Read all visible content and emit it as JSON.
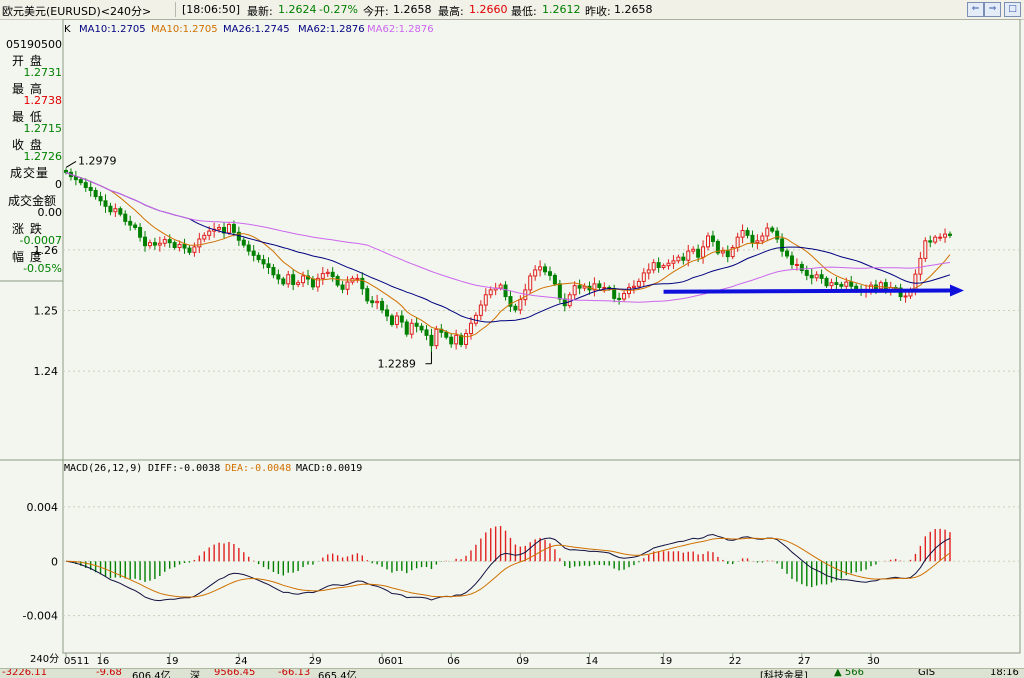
{
  "header": {
    "symbol": "欧元美元(EURUSD)<240分>",
    "time": "[18:06:50]",
    "latest_label": "最新:",
    "latest": "1.2624",
    "change": "-0.27%",
    "open_label": "今开:",
    "open": "1.2658",
    "high_label": "最高:",
    "high": "1.2660",
    "low_label": "最低:",
    "low": "1.2612",
    "prev_label": "昨收:",
    "prev": "1.2658"
  },
  "ma_legend": {
    "prefix": "K",
    "items": [
      {
        "text": "MA10:1.2705",
        "color": "#000080"
      },
      {
        "text": "MA10:1.2705",
        "color": "#d07000"
      },
      {
        "text": "MA26:1.2745",
        "color": "#000080"
      },
      {
        "text": "MA62:1.2876",
        "color": "#000080"
      },
      {
        "text": "MA62:1.2876",
        "color": "#cc66ee"
      }
    ]
  },
  "info_panel": {
    "code": "05190500",
    "rows": [
      {
        "label": "开  盘",
        "value": "1.2731",
        "color": "#008000"
      },
      {
        "label": "最  高",
        "value": "1.2738",
        "color": "#e00000"
      },
      {
        "label": "最  低",
        "value": "1.2715",
        "color": "#008000"
      },
      {
        "label": "收  盘",
        "value": "1.2726",
        "color": "#008000"
      },
      {
        "label": "成交量",
        "value": "0",
        "color": "#000000"
      },
      {
        "label": "成交金额",
        "value": "0.00",
        "color": "#000000"
      },
      {
        "label": "涨  跌",
        "value": "-0.0007",
        "color": "#008000"
      },
      {
        "label": "幅  度",
        "value": "-0.05%",
        "color": "#008000"
      }
    ]
  },
  "macd_legend": {
    "name": "MACD(26,12,9)",
    "diff": "DIFF:-0.0038",
    "dea": "DEA:-0.0048",
    "macd": "MACD:0.0019"
  },
  "period_label": "240分",
  "statusbar": {
    "left": [
      "-3226.11",
      "-9.68",
      "606.4亿",
      "深",
      "9566.45",
      "-66.13",
      "665.4亿"
    ],
    "right": [
      "[科技金星]",
      "▲ 566",
      "GIS",
      "18:16"
    ]
  },
  "chart_data": {
    "type": "candlestick",
    "price_axis": {
      "ticks": [
        1.24,
        1.25,
        1.26
      ],
      "tick_labels": [
        "1.24",
        "1.25",
        "1.26"
      ],
      "range": [
        1.2255,
        1.2915
      ]
    },
    "x_tick_labels": [
      "0511",
      "16",
      "19",
      "24",
      "29",
      "0601",
      "06",
      "09",
      "14",
      "19",
      "22",
      "27",
      "30"
    ],
    "annotations": [
      {
        "text": "1.2979",
        "kind": "high_marker"
      },
      {
        "text": "1.2289",
        "kind": "low_marker"
      }
    ],
    "close": [
      1.2728,
      1.2721,
      1.2716,
      1.2711,
      1.2703,
      1.2698,
      1.2688,
      1.2681,
      1.2672,
      1.2663,
      1.2668,
      1.2659,
      1.2647,
      1.2641,
      1.2637,
      1.2621,
      1.2607,
      1.2612,
      1.2608,
      1.2611,
      1.2617,
      1.2612,
      1.2604,
      1.2609,
      1.2603,
      1.2596,
      1.2605,
      1.2618,
      1.2624,
      1.2631,
      1.2634,
      1.2637,
      1.2628,
      1.2642,
      1.2629,
      1.2616,
      1.2608,
      1.2598,
      1.2591,
      1.2584,
      1.2577,
      1.2571,
      1.2559,
      1.2552,
      1.2544,
      1.2559,
      1.2543,
      1.2546,
      1.2557,
      1.2552,
      1.2539,
      1.2553,
      1.2561,
      1.2563,
      1.2556,
      1.2542,
      1.2535,
      1.2547,
      1.2553,
      1.2553,
      1.2536,
      1.2516,
      1.2513,
      1.2515,
      1.2501,
      1.2491,
      1.2477,
      1.2491,
      1.2481,
      1.2461,
      1.2479,
      1.2474,
      1.2468,
      1.2459,
      1.2442,
      1.2469,
      1.2464,
      1.2456,
      1.2445,
      1.2459,
      1.2444,
      1.2462,
      1.2479,
      1.2492,
      1.2509,
      1.2526,
      1.2534,
      1.2537,
      1.2542,
      1.2523,
      1.2507,
      1.2501,
      1.2518,
      1.2534,
      1.2557,
      1.2567,
      1.2572,
      1.2564,
      1.2558,
      1.2544,
      1.2519,
      1.2508,
      1.2526,
      1.2541,
      1.2537,
      1.254,
      1.2534,
      1.2544,
      1.2538,
      1.2538,
      1.2536,
      1.252,
      1.2519,
      1.2528,
      1.2538,
      1.254,
      1.2548,
      1.2562,
      1.2567,
      1.2579,
      1.2571,
      1.2574,
      1.2578,
      1.2582,
      1.2588,
      1.2583,
      1.2598,
      1.2601,
      1.2588,
      1.2605,
      1.2623,
      1.2614,
      1.2595,
      1.2598,
      1.2589,
      1.2604,
      1.2621,
      1.2632,
      1.2624,
      1.2612,
      1.2615,
      1.2623,
      1.2636,
      1.2631,
      1.2618,
      1.2598,
      1.259,
      1.2576,
      1.2576,
      1.2566,
      1.2558,
      1.2554,
      1.2559,
      1.2553,
      1.2541,
      1.2546,
      1.2543,
      1.254,
      1.2547,
      1.254,
      1.2534,
      1.2532,
      1.2532,
      1.2542,
      1.2536,
      1.2546,
      1.2534,
      1.2538,
      1.2537,
      1.2523,
      1.2524,
      1.2533,
      1.256,
      1.2586,
      1.2615,
      1.2613,
      1.2621,
      1.2621,
      1.2626,
      1.2624
    ],
    "open": [
      1.2731,
      1.2728,
      1.2721,
      1.2716,
      1.2711,
      1.2703,
      1.2698,
      1.2688,
      1.2681,
      1.2672,
      1.2663,
      1.2668,
      1.2659,
      1.2647,
      1.2641,
      1.2637,
      1.2621,
      1.2607,
      1.2612,
      1.2608,
      1.2611,
      1.2617,
      1.2612,
      1.2604,
      1.2609,
      1.2603,
      1.2596,
      1.2605,
      1.2618,
      1.2624,
      1.2631,
      1.2634,
      1.2637,
      1.2628,
      1.2642,
      1.2629,
      1.2616,
      1.2608,
      1.2598,
      1.2591,
      1.2584,
      1.2577,
      1.2571,
      1.2559,
      1.2552,
      1.2544,
      1.2559,
      1.2543,
      1.2546,
      1.2557,
      1.2552,
      1.2539,
      1.2553,
      1.2561,
      1.2563,
      1.2556,
      1.2542,
      1.2535,
      1.2547,
      1.2553,
      1.2553,
      1.2536,
      1.2516,
      1.2513,
      1.2515,
      1.2501,
      1.2491,
      1.2477,
      1.2491,
      1.2481,
      1.2461,
      1.2479,
      1.2474,
      1.2468,
      1.2459,
      1.2442,
      1.2469,
      1.2464,
      1.2456,
      1.2445,
      1.2459,
      1.2444,
      1.2462,
      1.2479,
      1.2492,
      1.2509,
      1.2526,
      1.2534,
      1.2537,
      1.2542,
      1.2523,
      1.2507,
      1.2501,
      1.2518,
      1.2534,
      1.2557,
      1.2567,
      1.2572,
      1.2564,
      1.2558,
      1.2544,
      1.2519,
      1.2508,
      1.2526,
      1.2541,
      1.2537,
      1.254,
      1.2534,
      1.2544,
      1.2538,
      1.2538,
      1.2536,
      1.252,
      1.2519,
      1.2528,
      1.2538,
      1.254,
      1.2548,
      1.2562,
      1.2567,
      1.2579,
      1.2571,
      1.2574,
      1.2578,
      1.2582,
      1.2588,
      1.2583,
      1.2598,
      1.2601,
      1.2588,
      1.2605,
      1.2623,
      1.2614,
      1.2595,
      1.2598,
      1.2589,
      1.2604,
      1.2621,
      1.2632,
      1.2624,
      1.2612,
      1.2615,
      1.2623,
      1.2636,
      1.2631,
      1.2618,
      1.2598,
      1.259,
      1.2576,
      1.2576,
      1.2566,
      1.2558,
      1.2554,
      1.2559,
      1.2553,
      1.2541,
      1.2546,
      1.2543,
      1.254,
      1.2547,
      1.254,
      1.2534,
      1.2532,
      1.2532,
      1.2542,
      1.2536,
      1.2546,
      1.2534,
      1.2538,
      1.2537,
      1.2523,
      1.2524,
      1.2533,
      1.256,
      1.2586,
      1.2615,
      1.2613,
      1.2621,
      1.2621,
      1.2626
    ],
    "moving_averages": [
      {
        "name": "MA10",
        "color": "#d07000"
      },
      {
        "name": "MA26",
        "color": "#000080"
      },
      {
        "name": "MA62",
        "color": "#cc66ee"
      }
    ],
    "trend_arrow": {
      "from": [
        121,
        1.2531
      ],
      "to": [
        179,
        1.2533
      ],
      "color": "#1010dd"
    },
    "macd_panel": {
      "ticks": [
        0.004,
        0,
        -0.004
      ],
      "tick_labels": [
        "0.004",
        "0",
        "-0.004"
      ],
      "range": [
        -0.0066,
        0.0062
      ]
    }
  }
}
